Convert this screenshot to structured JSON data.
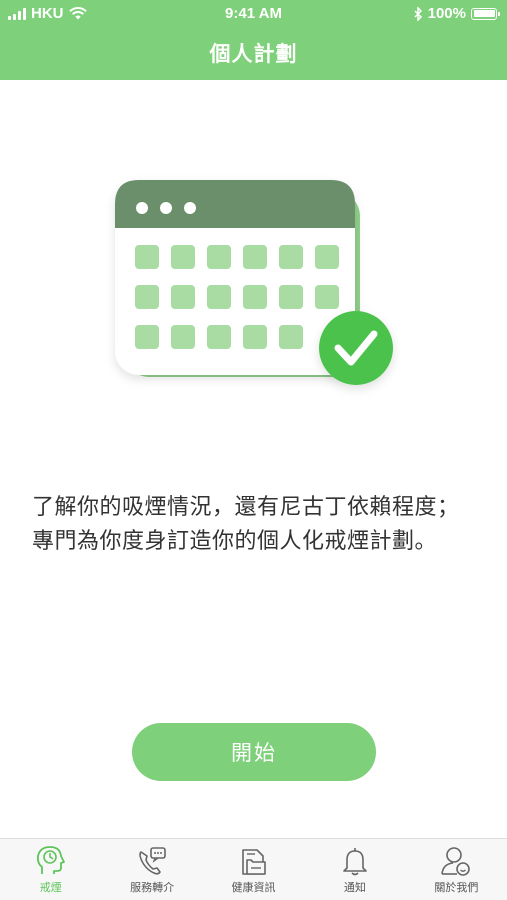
{
  "status_bar": {
    "carrier": "HKU",
    "time": "9:41 AM",
    "battery": "100%"
  },
  "header": {
    "title": "個人計劃"
  },
  "content": {
    "description": "了解你的吸煙情況，還有尼古丁依賴程度；專門為你度身訂造你的個人化戒煙計劃。",
    "start_button": "開始"
  },
  "tabs": [
    {
      "label": "戒煙",
      "icon": "head-clock-icon",
      "active": true
    },
    {
      "label": "服務轉介",
      "icon": "phone-chat-icon",
      "active": false
    },
    {
      "label": "健康資訊",
      "icon": "document-folder-icon",
      "active": false
    },
    {
      "label": "通知",
      "icon": "bell-icon",
      "active": false
    },
    {
      "label": "關於我們",
      "icon": "person-smile-icon",
      "active": false
    }
  ],
  "colors": {
    "brand_green": "#7ed07a",
    "calendar_header": "#6a8f6a",
    "check_green": "#4cc24c"
  }
}
